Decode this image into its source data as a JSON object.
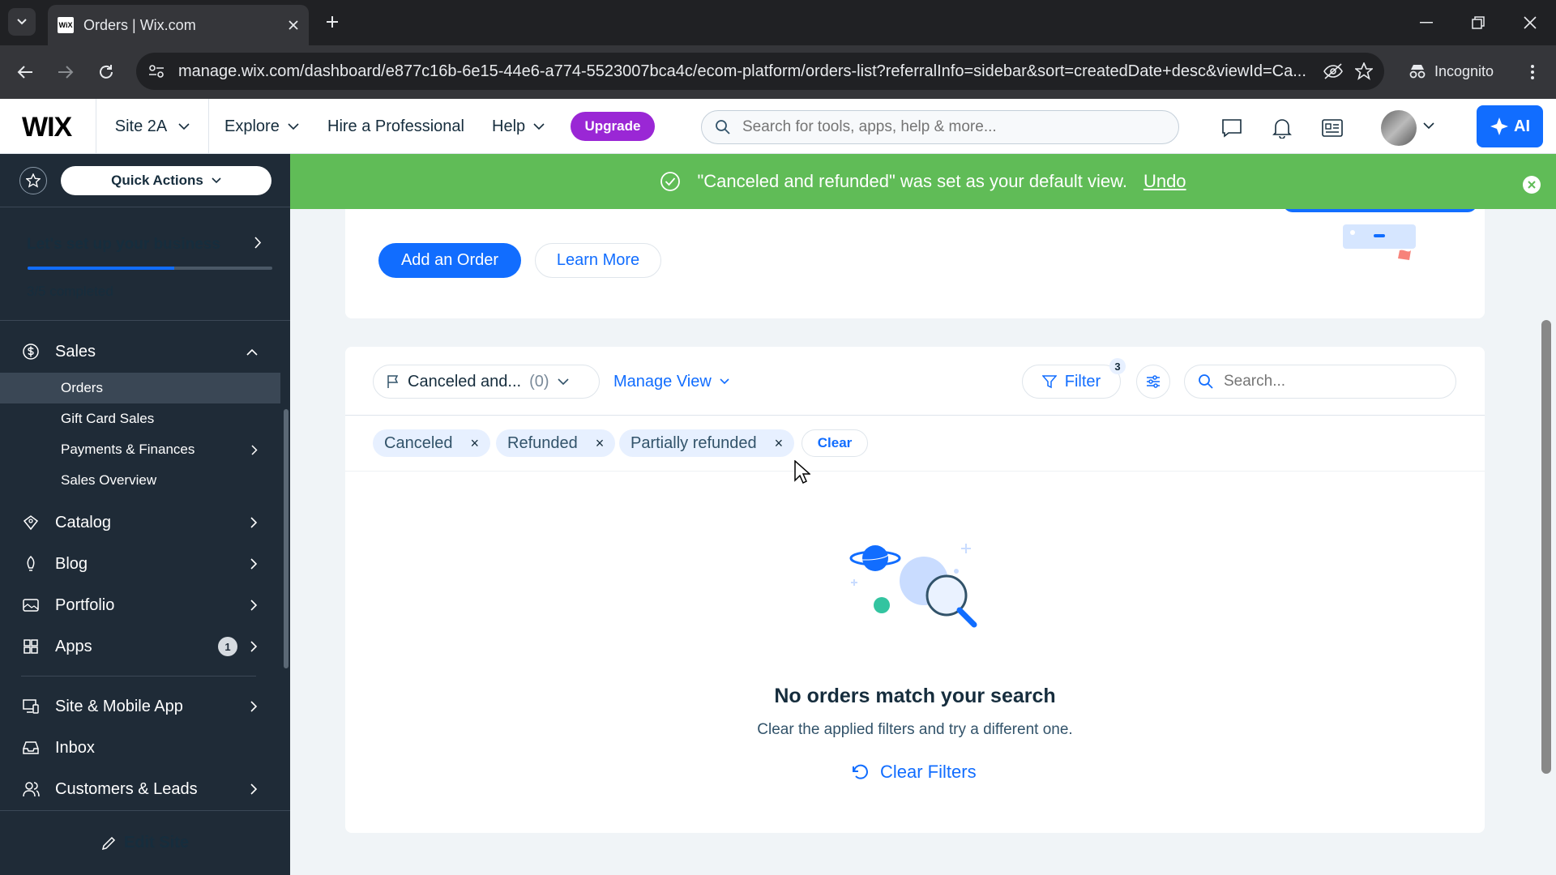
{
  "browser": {
    "tab_title": "Orders | Wix.com",
    "favicon_text": "WiX",
    "url": "manage.wix.com/dashboard/e877c16b-6e15-44e6-a774-5523007bca4c/ecom-platform/orders-list?referralInfo=sidebar&sort=createdDate+desc&viewId=Ca...",
    "incognito_label": "Incognito"
  },
  "header": {
    "logo": "WIX",
    "site_name": "Site 2A",
    "nav": [
      "Explore",
      "Hire a Professional",
      "Help"
    ],
    "upgrade_label": "Upgrade",
    "search_placeholder": "Search for tools, apps, help & more...",
    "ai_label": "AI"
  },
  "sidebar": {
    "quick_actions": "Quick Actions",
    "setup_title": "Let's set up your business",
    "setup_progress": 0.6,
    "setup_count": "3/5 completed",
    "sales": "Sales",
    "sub_items": [
      "Orders",
      "Gift Card Sales",
      "Payments & Finances",
      "Sales Overview"
    ],
    "items": [
      "Catalog",
      "Blog",
      "Portfolio",
      "Apps",
      "Site & Mobile App",
      "Inbox",
      "Customers & Leads"
    ],
    "apps_badge": "1",
    "edit_site": "Edit Site"
  },
  "toast": {
    "message": "\"Canceled and refunded\" was set as your default view.",
    "undo": "Undo"
  },
  "main": {
    "add_order": "Add an Order",
    "learn_more": "Learn More",
    "view_name": "Canceled and...",
    "view_count": "(0)",
    "manage_view": "Manage View",
    "filter_label": "Filter",
    "filter_count": "3",
    "search_placeholder": "Search...",
    "chips": [
      "Canceled",
      "Refunded",
      "Partially refunded"
    ],
    "clear_label": "Clear",
    "empty_title": "No orders match your search",
    "empty_subtitle": "Clear the applied filters and try a different one.",
    "clear_filters": "Clear Filters"
  },
  "colors": {
    "accent": "#116dff",
    "toast": "#60bc57",
    "sidebar": "#1f2b37",
    "upgrade": "#9a27d5"
  }
}
